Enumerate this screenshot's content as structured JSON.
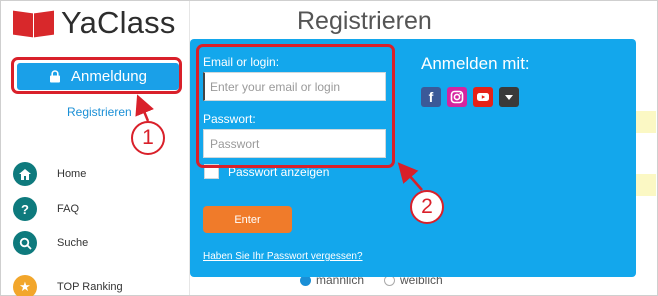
{
  "app": {
    "logo_text": "YaClass"
  },
  "sidebar": {
    "login_label": "Anmeldung",
    "register_label": "Registrieren",
    "items": [
      {
        "label": "Home",
        "icon": "home-icon"
      },
      {
        "label": "FAQ",
        "icon": "question-icon"
      },
      {
        "label": "Suche",
        "icon": "search-icon"
      },
      {
        "label": "TOP Ranking",
        "icon": "star-icon"
      }
    ]
  },
  "main": {
    "title": "Registrieren",
    "gender_options": [
      "männlich",
      "weiblich"
    ]
  },
  "login_panel": {
    "email_label": "Email or login:",
    "email_placeholder": "Enter your email or login",
    "password_label": "Passwort:",
    "password_placeholder": "Passwort",
    "show_password_label": "Passwort anzeigen",
    "enter_label": "Enter",
    "forgot_label": "Haben Sie Ihr Passwort vergessen?",
    "social_title": "Anmelden mit:",
    "social_icons": [
      "facebook-icon",
      "instagram-icon",
      "youtube-icon",
      "more-icon"
    ]
  },
  "annotations": {
    "marker_1": "1",
    "marker_2": "2"
  },
  "colors": {
    "panel_blue": "#13a7ec",
    "login_button_blue": "#1aa0e8",
    "enter_orange": "#f07b2a",
    "highlight_red": "#d9202a",
    "logo_red": "#d8282b"
  }
}
